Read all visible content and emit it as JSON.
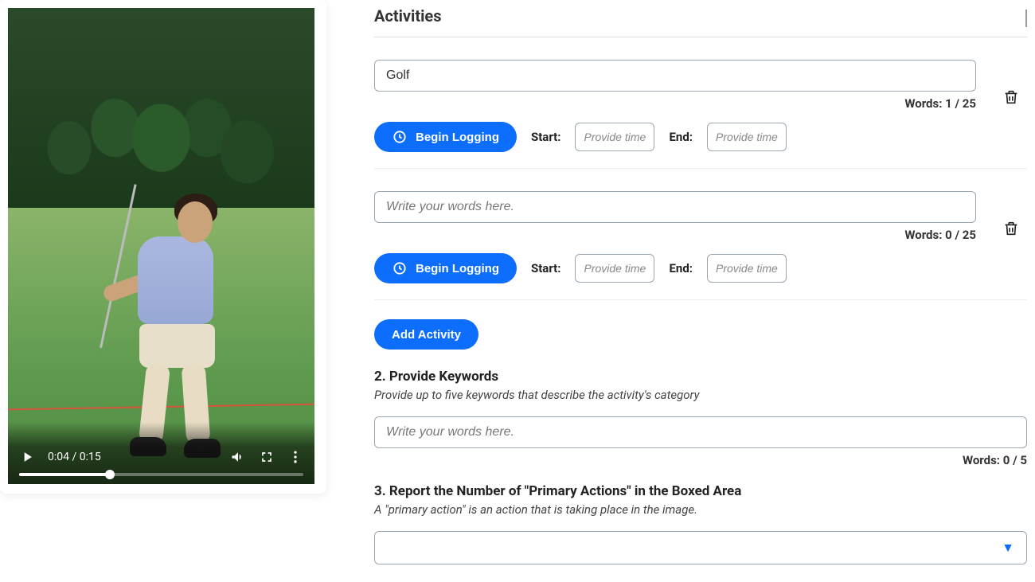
{
  "video": {
    "current_time": "0:04",
    "total_time": "0:15",
    "display": "0:04 / 0:15"
  },
  "activities": {
    "title": "Activities",
    "items": [
      {
        "value": "Golf",
        "placeholder": "Write your words here.",
        "word_count": "Words: 1 / 25",
        "begin_label": "Begin Logging",
        "start_label": "Start:",
        "end_label": "End:",
        "time_placeholder": "Provide time"
      },
      {
        "value": "",
        "placeholder": "Write your words here.",
        "word_count": "Words: 0 / 25",
        "begin_label": "Begin Logging",
        "start_label": "Start:",
        "end_label": "End:",
        "time_placeholder": "Provide time"
      }
    ],
    "add_label": "Add Activity"
  },
  "keywords": {
    "title": "2. Provide Keywords",
    "desc": "Provide up to five keywords that describe the activity's category",
    "placeholder": "Write your words here.",
    "word_count": "Words: 0 / 5"
  },
  "primary_actions": {
    "title": "3. Report the Number of \"Primary Actions\" in the Boxed Area",
    "desc": "A \"primary action\" is an action that is taking place in the image."
  }
}
